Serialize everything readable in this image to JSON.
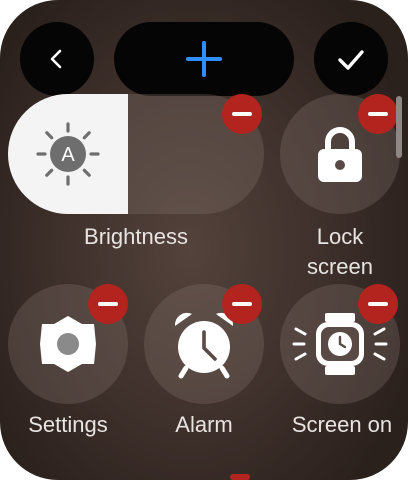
{
  "topbar": {
    "back": "chevron-left-icon",
    "add": "plus-icon",
    "done": "checkmark-icon",
    "add_color": "#2f8fff"
  },
  "tiles": [
    {
      "id": "brightness",
      "label": "Brightness",
      "icon": "brightness-auto-icon",
      "level": 0.47
    },
    {
      "id": "lock",
      "label": "Lock\nscreen",
      "icon": "lock-icon"
    },
    {
      "id": "settings",
      "label": "Settings",
      "icon": "gear-icon"
    },
    {
      "id": "alarm",
      "label": "Alarm",
      "icon": "alarm-clock-icon"
    },
    {
      "id": "screen_on",
      "label": "Screen on",
      "icon": "watch-screen-on-icon"
    }
  ],
  "brightness_badge": "A",
  "colors": {
    "remove_badge": "#b3241f",
    "tile_active": "#f4f4f4"
  }
}
